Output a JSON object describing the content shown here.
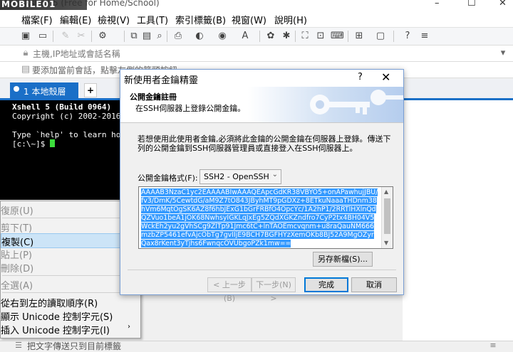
{
  "window": {
    "title": "Xshell 5 (Free for Home/School)",
    "watermark": "MOBILE01",
    "controls": [
      "–",
      "☐",
      "✕"
    ]
  },
  "menu": [
    "檔案(F)",
    "編輯(E)",
    "檢視(V)",
    "工具(T)",
    "索引標籤(B)",
    "視窗(W)",
    "說明(H)"
  ],
  "address_bar": {
    "placeholder": "主機,IP地址或會話名稱"
  },
  "hint_bar": {
    "text": "要添加當前會話，點擊左側的箭頭按鈕。"
  },
  "tabs": [
    {
      "label": "1 本地殼層"
    }
  ],
  "terminal": {
    "lines": [
      "Xshell 5 (Build 0964)",
      "Copyright (c) 2002-2016 Ne",
      "",
      "Type `help' to learn how t",
      "[c:\\~]$ "
    ]
  },
  "context_menu": {
    "items": [
      {
        "label": "復原(U)",
        "disabled": true
      },
      {
        "label": "剪下(T)",
        "disabled": true
      },
      {
        "label": "複製(C)",
        "disabled": false,
        "selected": true
      },
      {
        "label": "貼上(P)",
        "disabled": true
      },
      {
        "label": "刪除(D)",
        "disabled": true
      },
      {
        "label": "全選(A)",
        "disabled": true
      },
      {
        "label": "從右到左的讀取順序(R)",
        "disabled": false
      },
      {
        "label": "顯示 Unicode 控制字元(S)",
        "disabled": false
      },
      {
        "label": "插入 Unicode 控制字元(I)",
        "disabled": false,
        "submenu": true
      }
    ]
  },
  "status_bar": {
    "text": "把文字傳送只到目前標籤"
  },
  "dialog": {
    "title": "新使用者金鑰精靈",
    "help": "?",
    "close": "✕",
    "header_title": "公開金鑰註冊",
    "header_subtitle": "在SSH伺服器上登錄公開金鑰。",
    "description": "若想使用此使用者金鑰,必須將此金鑰的公開金鑰在伺服器上登錄。傳送下列的公開金鑰到SSH伺服器管理員或直接登入在SSH伺服器上。",
    "format_label": "公開金鑰格式(F):",
    "format_value": "SSH2 - OpenSSH",
    "public_key": "AAAAB3NzaC1yc2EAAAABIwAAAQEApcGdKR38VBYO5+onAPawhujJBU/fv3/DmK/5CewtdG/aM9Z7tO843JByhMT9pGDXz+8ETkuNaaaTHDnm38hVm6MqtOgSK6AZ8f6hbJExG1bGrFRBfO4OpcYc/1A2hP1/2RRTlHXlnQdQZVuo1beA1jOK68NwhsyIGKLqJxEg5ZQdXGKZndfro7CyP2tx4BH04V5WckEh2yu2gVhSCg9ZlTp91Jmc6tC+lnTAOEmcvqnm+u8raQauNM666mzbZP5461efvAjcObTg7gvIIjE9BCH7BGFHYzXemOKb8BJ52A9MgOZyrQax8rKent3yTjhs6FwnqcOVUbgoPZk1mw=="
  },
  "buttons": {
    "save_as": "另存新檔(S)...",
    "back": "< 上一步(B)",
    "next": "下一步(N) >",
    "finish": "完成",
    "cancel": "取消"
  }
}
